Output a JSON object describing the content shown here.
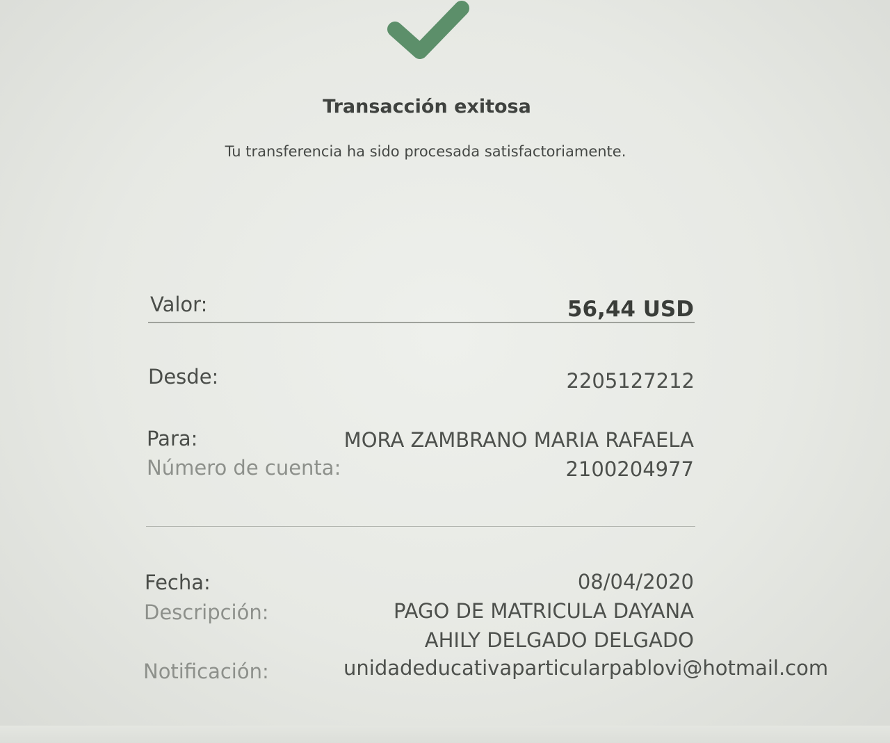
{
  "status": {
    "icon": "checkmark-icon",
    "color": "#5c8f6a",
    "title": "Transacción exitosa",
    "message": "Tu transferencia ha sido procesada satisfactoriamente."
  },
  "details": {
    "valor_label": "Valor:",
    "valor_value": "56,44 USD",
    "desde_label": "Desde:",
    "desde_value": "2205127212",
    "para_label": "Para:",
    "para_value": "MORA ZAMBRANO MARIA RAFAELA",
    "cuenta_label": "Número de cuenta:",
    "cuenta_value": "2100204977",
    "fecha_label": "Fecha:",
    "fecha_value": "08/04/2020",
    "descripcion_label": "Descripción:",
    "descripcion_line1": "PAGO DE MATRICULA DAYANA",
    "descripcion_line2": "AHILY DELGADO DELGADO",
    "notificacion_label": "Notificación:",
    "notificacion_value": "unidadeducativaparticularpablovi@hotmail.com"
  }
}
